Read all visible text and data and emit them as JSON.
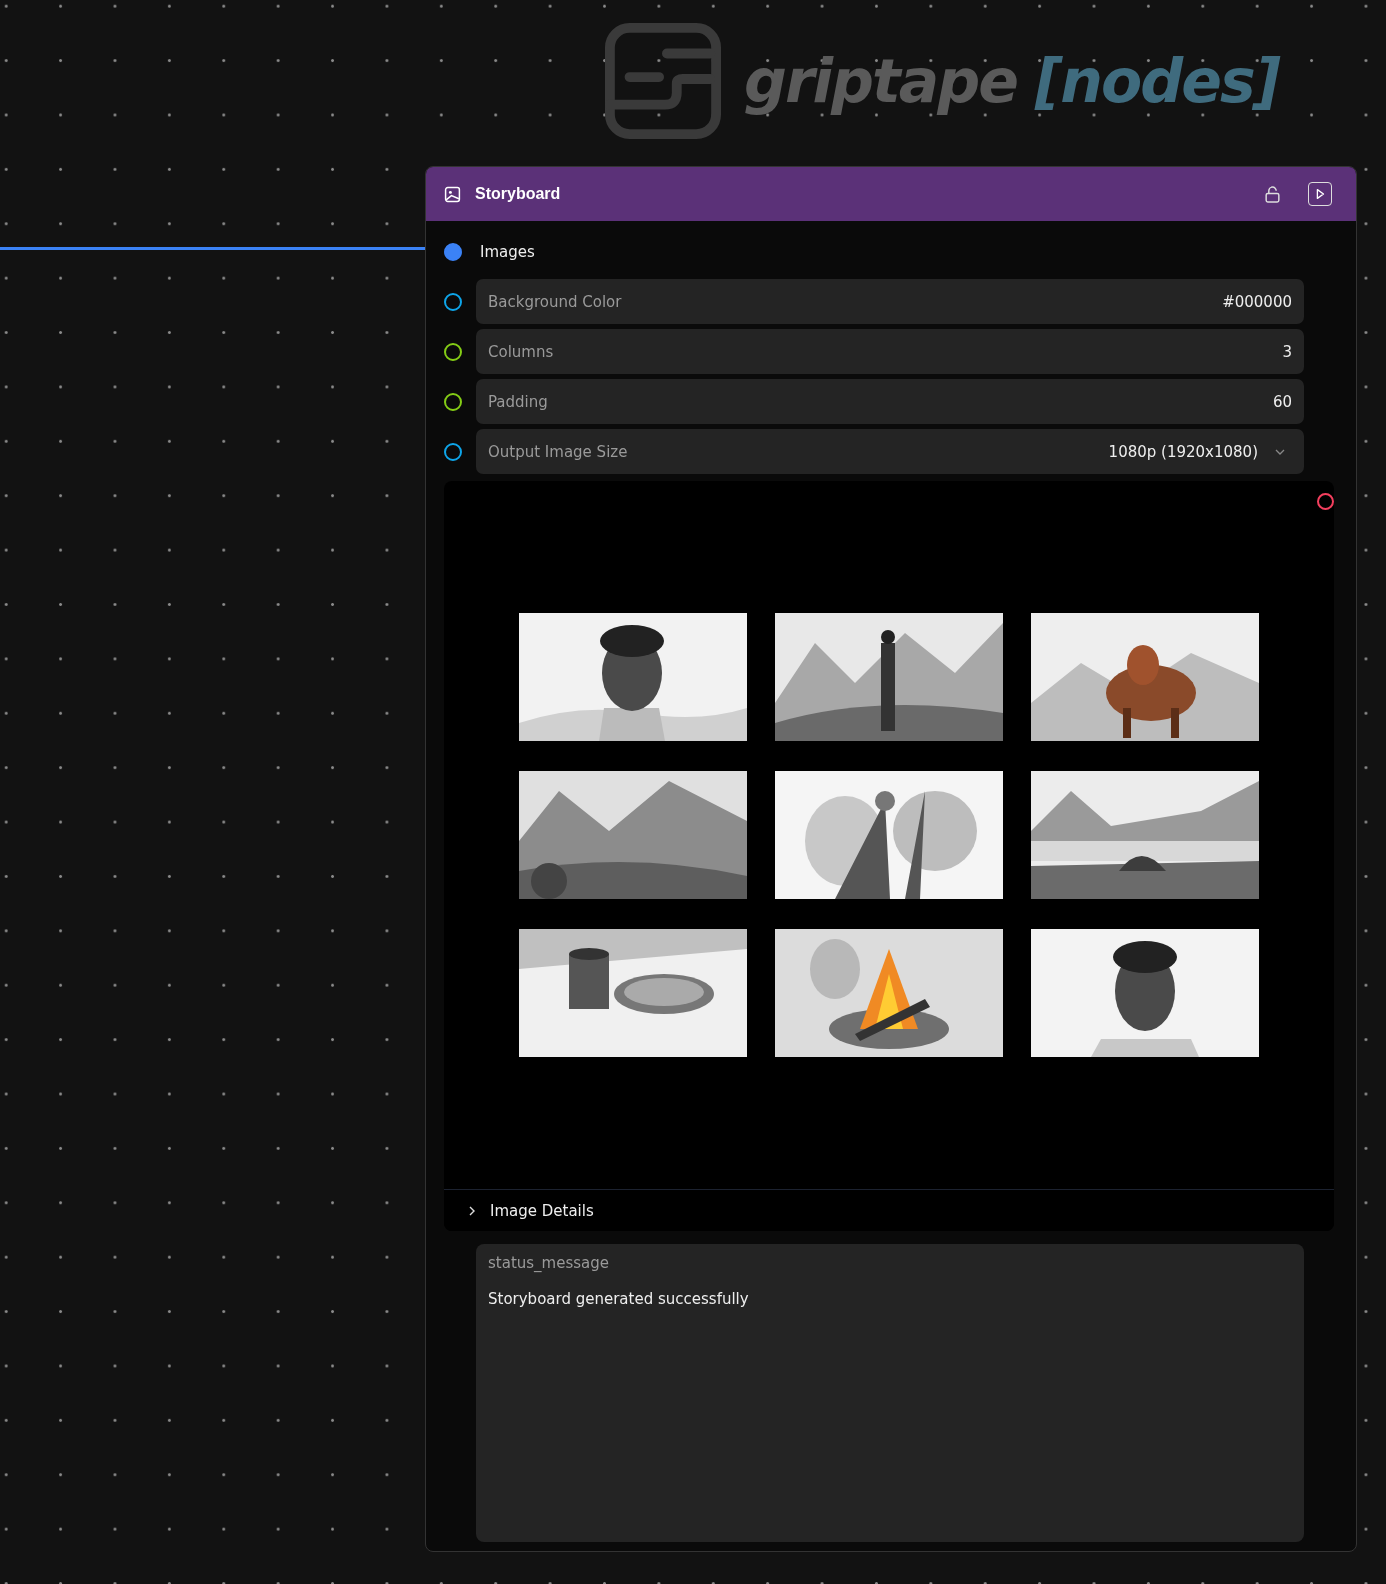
{
  "logo": {
    "name": "griptape",
    "suffix": "[nodes]"
  },
  "node": {
    "title": "Storyboard",
    "locked": false,
    "input": {
      "label": "Images",
      "color": "#3b82f6",
      "connected": true
    },
    "parameters": [
      {
        "kind": "text",
        "label": "Background Color",
        "value": "#000000",
        "color": "#0ea5e9",
        "connected": false
      },
      {
        "kind": "text",
        "label": "Columns",
        "value": "3",
        "color": "#84cc16",
        "connected": false
      },
      {
        "kind": "text",
        "label": "Padding",
        "value": "60",
        "color": "#84cc16",
        "connected": false
      },
      {
        "kind": "dropdown",
        "label": "Output Image Size",
        "value": "1080p (1920x1080)",
        "color": "#0ea5e9",
        "connected": false
      }
    ],
    "preview": {
      "output": {
        "color": "#f43f5e"
      },
      "details": {
        "label": "Image Details",
        "expanded": false
      }
    },
    "status": {
      "label": "status_message",
      "value": "Storyboard generated successfully"
    }
  }
}
